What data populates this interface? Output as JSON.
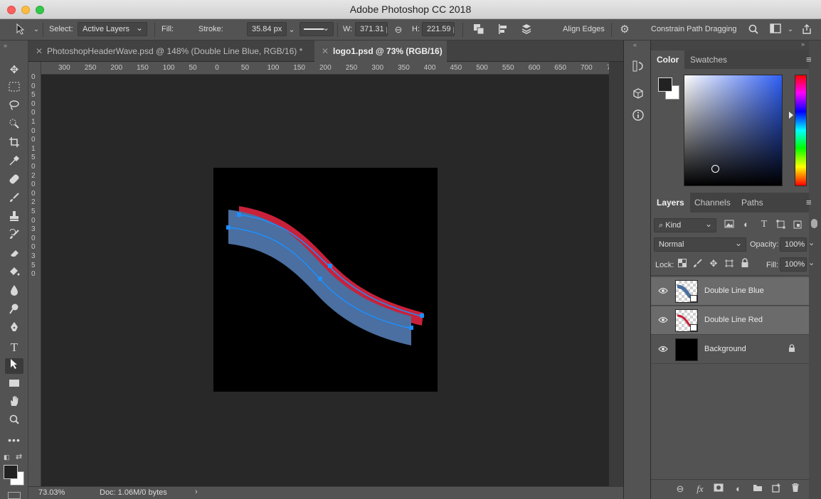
{
  "window": {
    "title": "Adobe Photoshop CC 2018"
  },
  "options_bar": {
    "select_label": "Select:",
    "select_value": "Active Layers",
    "fill_label": "Fill:",
    "fill_color": "#4a6fa0",
    "stroke_label": "Stroke:",
    "stroke_width": "35.84 px",
    "w_label": "W:",
    "w_value": "371.31 p",
    "h_label": "H:",
    "h_value": "221.59 p",
    "align_edges_label": "Align Edges",
    "align_edges_checked": true,
    "constrain_label": "Constrain Path Dragging",
    "constrain_checked": false
  },
  "tabs": [
    {
      "label": "PhotoshopHeaderWave.psd @ 148% (Double Line Blue, RGB/16) *",
      "active": false
    },
    {
      "label": "logo1.psd @ 73% (RGB/16)",
      "active": true
    }
  ],
  "ruler": {
    "h_labels": [
      "300",
      "250",
      "200",
      "150",
      "100",
      "50",
      "0",
      "50",
      "100",
      "150",
      "200",
      "250",
      "300",
      "350",
      "400",
      "450",
      "500",
      "550",
      "600",
      "650",
      "700",
      "7"
    ],
    "v_labels": [
      "0",
      "0",
      "5",
      "0",
      "0",
      "1",
      "0",
      "0",
      "1",
      "5",
      "0",
      "2",
      "0",
      "0",
      "2",
      "5",
      "0",
      "3",
      "0",
      "0",
      "3",
      "5",
      "0"
    ]
  },
  "status": {
    "zoom": "73.03%",
    "doc": "Doc: 1.06M/0 bytes",
    "arrow": "›"
  },
  "color_panel": {
    "tabs": [
      "Color",
      "Swatches"
    ],
    "active_tab": "Color",
    "foreground": "#222222",
    "background": "#ffffff",
    "hue_color": "#2f5ff5"
  },
  "layers_panel": {
    "tabs": [
      "Layers",
      "Channels",
      "Paths"
    ],
    "filter_label": "Kind",
    "blend_mode": "Normal",
    "opacity_label": "Opacity:",
    "opacity_value": "100%",
    "lock_label": "Lock:",
    "fill_label": "Fill:",
    "fill_value": "100%",
    "layers": [
      {
        "name": "Double Line Blue",
        "selected": true,
        "visible": true
      },
      {
        "name": "Double Line Red",
        "selected": true,
        "visible": true
      },
      {
        "name": "Background",
        "selected": false,
        "visible": true,
        "locked": true
      }
    ]
  },
  "artwork": {
    "blue_fill": "#4a6fa0",
    "red_fill": "#c8223a",
    "path_color": "#1e8fff",
    "document_color": "#000000"
  }
}
